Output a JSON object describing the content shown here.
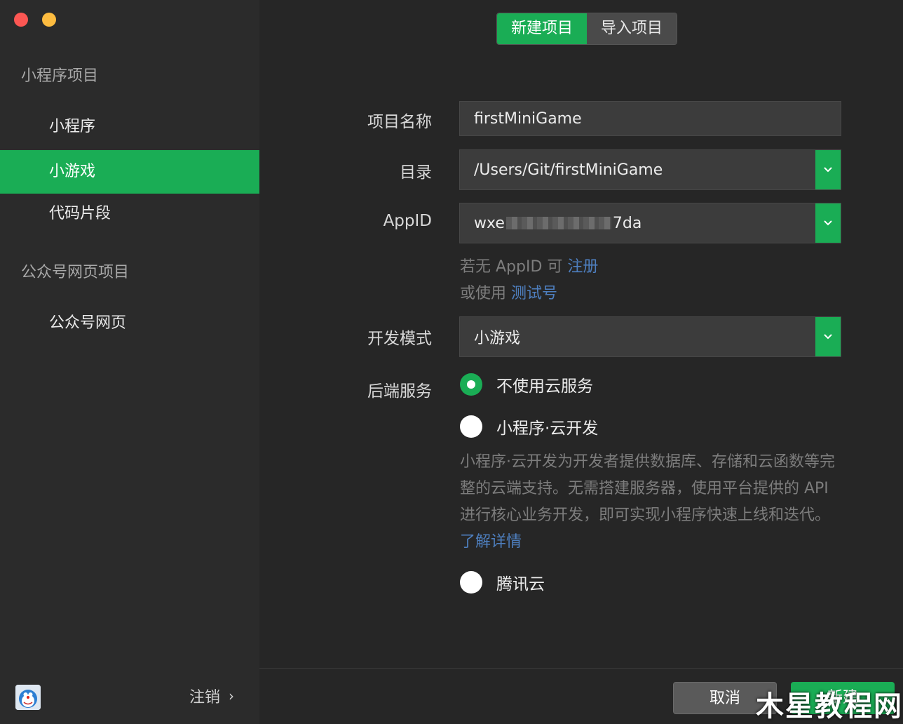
{
  "sidebar": {
    "section_miniprogram": "小程序项目",
    "items": [
      {
        "label": "小程序"
      },
      {
        "label": "小游戏"
      },
      {
        "label": "代码片段"
      }
    ],
    "section_official": "公众号网页项目",
    "official_item": "公众号网页",
    "logout_label": "注销",
    "logout_chevron": "›"
  },
  "tabs": [
    {
      "label": "新建项目"
    },
    {
      "label": "导入项目"
    }
  ],
  "form": {
    "name_label": "项目名称",
    "name_value": "firstMiniGame",
    "dir_label": "目录",
    "dir_value": "/Users/Git/firstMiniGame",
    "appid_label": "AppID",
    "appid_prefix": "wxe",
    "appid_suffix": "7da",
    "hint_line1_prefix": "若无 AppID 可 ",
    "hint_line1_link": "注册",
    "hint_line2_prefix": "或使用 ",
    "hint_line2_link": "测试号",
    "mode_label": "开发模式",
    "mode_value": "小游戏",
    "backend_label": "后端服务",
    "backend_options": [
      {
        "label": "不使用云服务"
      },
      {
        "label": "小程序·云开发"
      },
      {
        "label": "腾讯云"
      }
    ],
    "cloud_desc": "小程序·云开发为开发者提供数据库、存储和云函数等完整的云端支持。无需搭建服务器，使用平台提供的 API 进行核心业务开发，即可实现小程序快速上线和迭代。",
    "cloud_link": "了解详情"
  },
  "footer": {
    "cancel_label": "取消",
    "create_label": "新建"
  },
  "watermark": "木星教程网",
  "icons": {
    "dropdown": "⌄",
    "avatar": "doraemon-avatar-icon"
  },
  "colors": {
    "accent": "#1aad55",
    "link": "#4e7fbf",
    "background": "#262626",
    "sidebar": "#2b2b2b"
  }
}
